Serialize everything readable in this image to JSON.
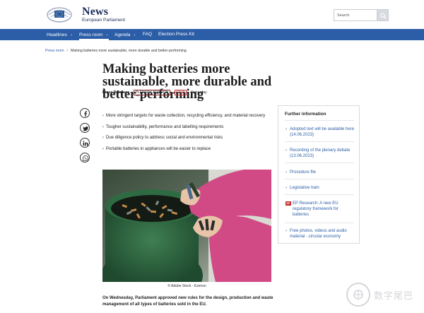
{
  "header": {
    "logo_title": "News",
    "logo_subtitle": "European Parliament",
    "search_placeholder": "Search"
  },
  "nav": {
    "items": [
      {
        "label": "Headlines",
        "has_dropdown": true
      },
      {
        "label": "Press room",
        "has_dropdown": true,
        "active": true
      },
      {
        "label": "Agenda",
        "has_dropdown": true
      },
      {
        "label": "FAQ",
        "has_dropdown": false
      },
      {
        "label": "Election Press Kit",
        "has_dropdown": false
      }
    ]
  },
  "breadcrumb": {
    "root": "Press room",
    "separator": "/",
    "current": "Making batteries more sustainable, more durable and better-performing"
  },
  "article": {
    "title": "Making batteries more sustainable, more durable and better-performing",
    "type": "Press Releases",
    "tags": [
      "PLENARY SESSION",
      "ENVI"
    ],
    "date": "Yesterday",
    "bullets": [
      "More stringent targets for waste collection, recycling efficiency, and material recovery",
      "Tougher sustainability, performance and labelling requirements",
      "Due diligence policy to address social and environmental risks",
      "Portable batteries in appliances will be easier to replace"
    ],
    "photo_caption": "© Adobe Stock - Kzenon",
    "lead": "On Wednesday, Parliament approved new rules for the design, production and waste management of all types of batteries sold in the EU."
  },
  "share": {
    "icons": [
      "facebook-icon",
      "twitter-icon",
      "linkedin-icon",
      "whatsapp-icon"
    ]
  },
  "sidebar": {
    "title": "Further information",
    "links": [
      {
        "text": "Adopted text will be available here (14.06.2023)"
      },
      {
        "text": "Recording of the plenary debate (13.06.2023)"
      },
      {
        "text": "Procedure file"
      },
      {
        "text": "Legislative train"
      },
      {
        "text": "EP Research: A new EU regulatory framework for batteries",
        "badge": "EP"
      },
      {
        "text": "Free photos, videos and audio material - circular economy"
      }
    ]
  },
  "watermark": {
    "text": "数字尾巴"
  },
  "colors": {
    "nav_bg": "#2c5ea7",
    "link": "#2c5ea7",
    "brand_text": "#1b2a5c",
    "tag_red": "#c23030"
  }
}
